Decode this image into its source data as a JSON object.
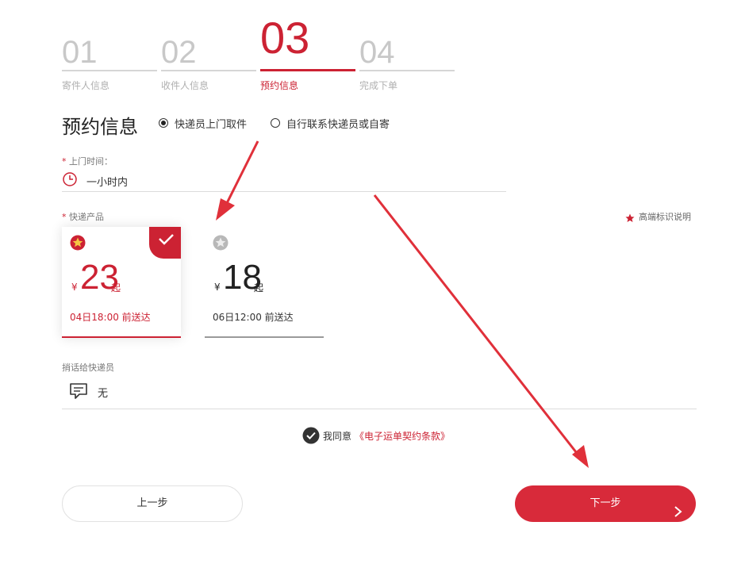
{
  "steps": [
    {
      "num": "01",
      "label": "寄件人信息"
    },
    {
      "num": "02",
      "label": "收件人信息"
    },
    {
      "num": "03",
      "label": "预约信息"
    },
    {
      "num": "04",
      "label": "完成下单"
    }
  ],
  "colors": {
    "accent": "#cc2233",
    "inactive": "#c8c8c8"
  },
  "section": {
    "title": "预约信息"
  },
  "pickup_options": [
    {
      "label": "快递员上门取件",
      "selected": true
    },
    {
      "label": "自行联系快递员或自寄",
      "selected": false
    }
  ],
  "pickup_time": {
    "label": "上门时间：",
    "required_mark": "*",
    "value": "一小时内",
    "icon": "clock-icon"
  },
  "product": {
    "label": "快递产品",
    "required_mark": "*",
    "legend_text": "高端标识说明",
    "cards": [
      {
        "currency": "¥",
        "price": "23",
        "suffix": "起",
        "delivery": "04日18:00 前送达",
        "selected": true,
        "icon": "premium-badge-icon"
      },
      {
        "currency": "¥",
        "price": "18",
        "suffix": "起",
        "delivery": "06日12:00 前送达",
        "selected": false,
        "icon": "standard-badge-icon"
      }
    ]
  },
  "message": {
    "label": "捎话给快递员",
    "value": "无",
    "icon": "message-icon"
  },
  "agreement": {
    "prefix": "我同意",
    "link": "《电子运单契约条款》",
    "checked": true
  },
  "buttons": {
    "prev": "上一步",
    "next": "下一步"
  }
}
